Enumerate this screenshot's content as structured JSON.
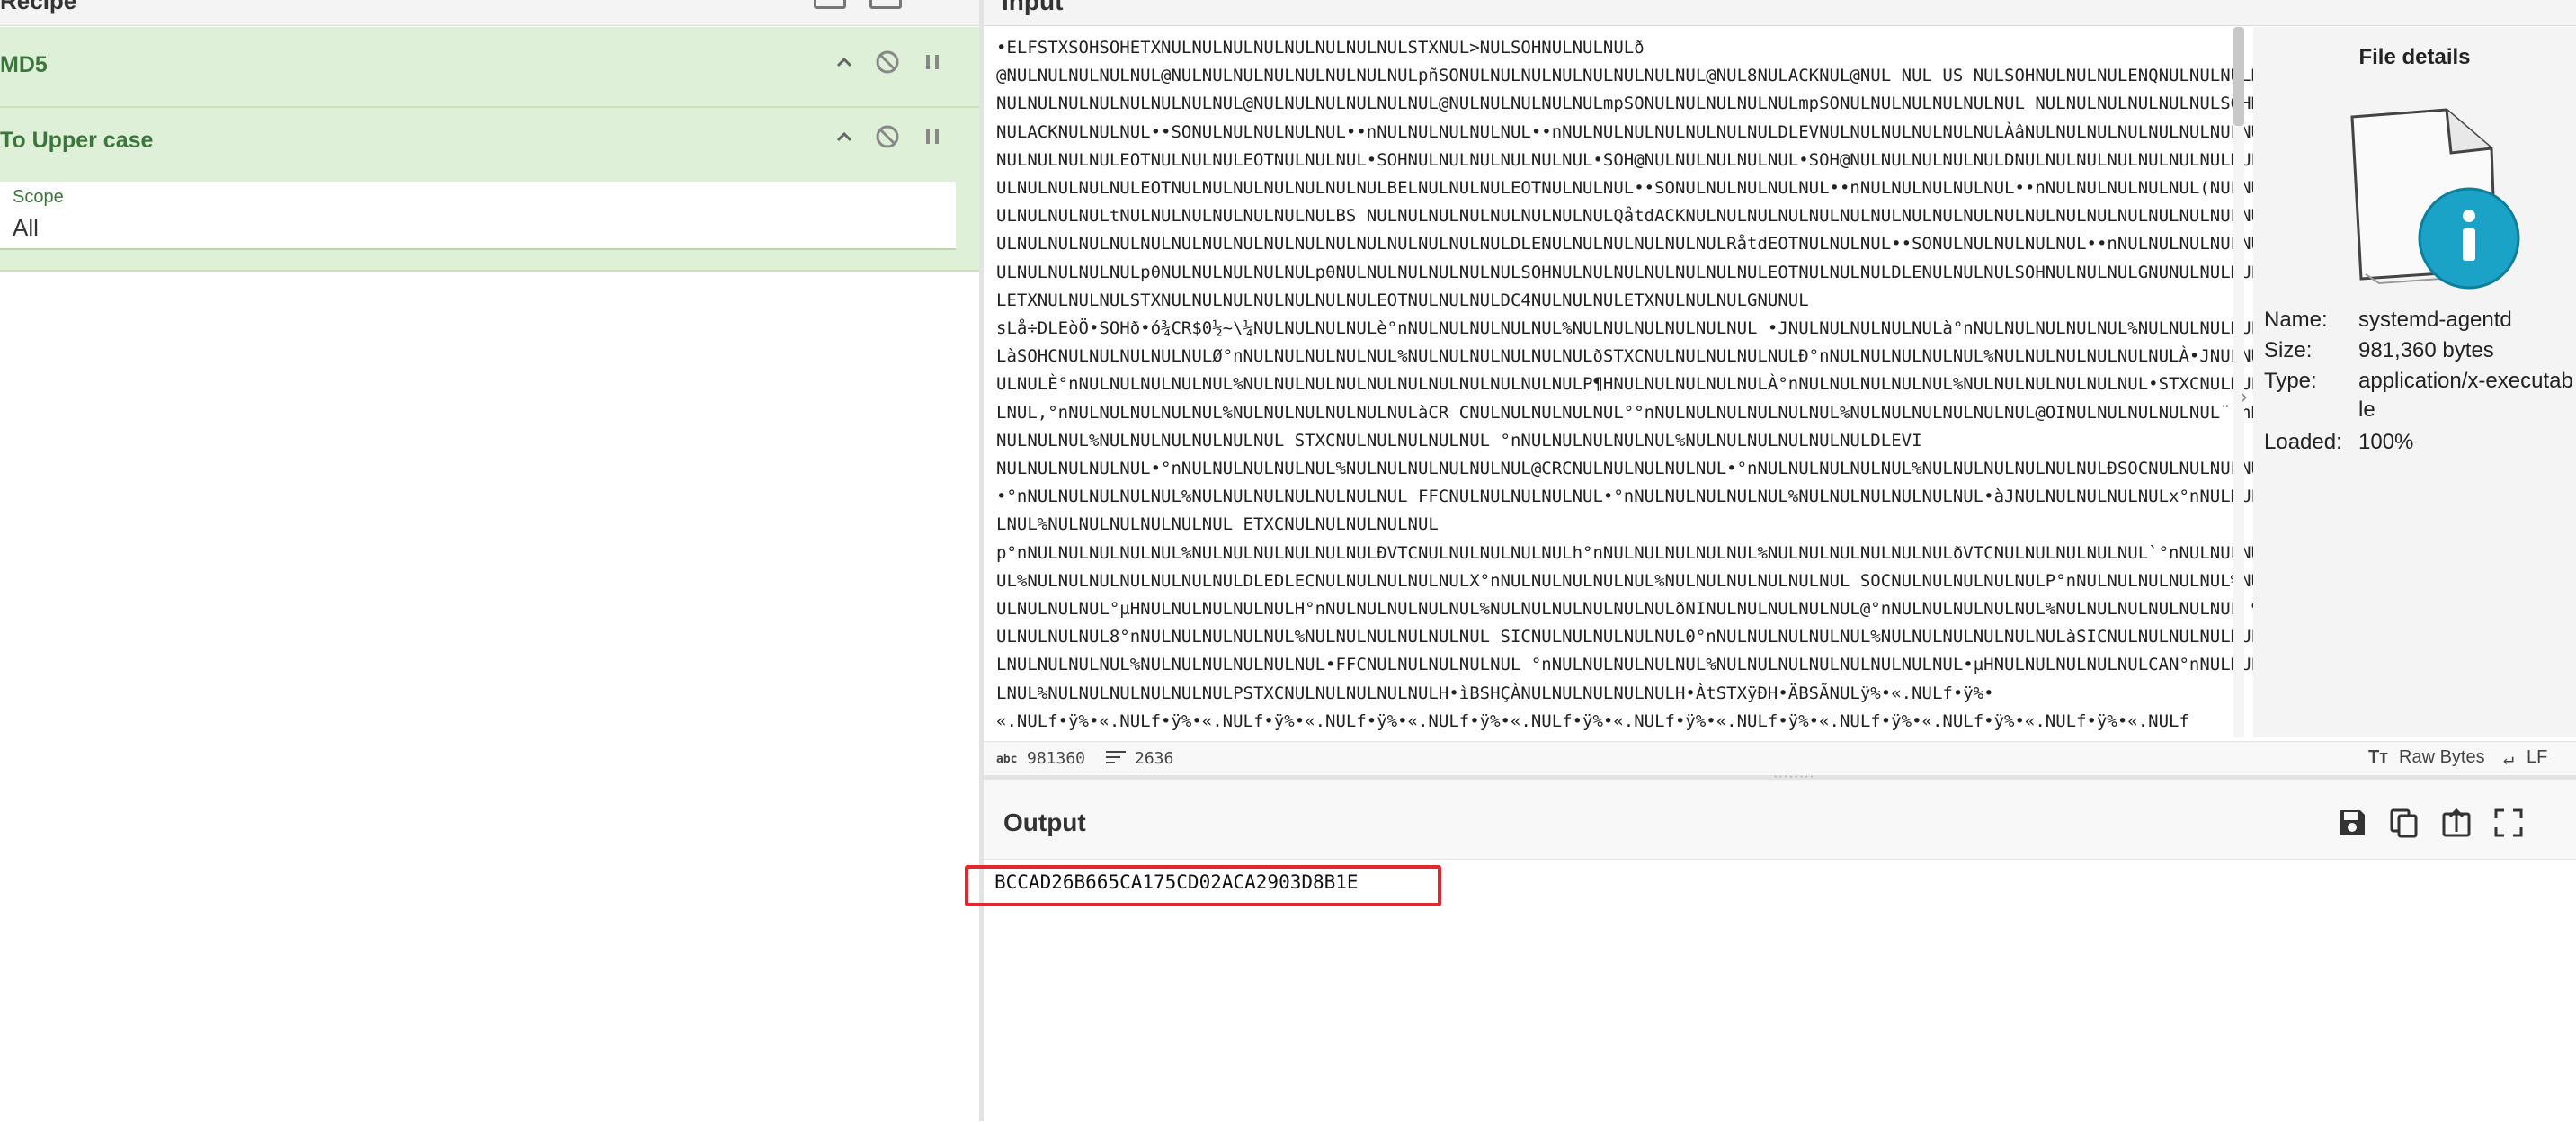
{
  "recipe": {
    "title": "Recipe",
    "operations": [
      {
        "name": "MD5"
      },
      {
        "name": "To Upper case",
        "scope_label": "Scope",
        "scope_value": "All"
      }
    ],
    "op_icons": [
      "chevron-up-icon",
      "disable-icon",
      "pause-icon"
    ]
  },
  "input": {
    "title": "Input",
    "text": "•ELFSTXSOHSOHETXNULNULNULNULNULNULNULNULSTXNUL>NULSOHNULNULNULð\n@NULNULNULNULNUL@NULNULNULNULNULNULNULNULpñSONULNULNULNULNULNULNULNUL@NUL8NULACKNUL@NUL NUL US NULSOHNULNULNULENQNULNULNULNULNULNULNULNULNULNULNULNULNUL@NULNULNULNULNULNUL@NULNULNULNULNULmpSONULNULNULNULNULmpSONULNULNULNULNULNUL NULNULNULNULNULNULSOHNULNULNULACKNULNULNUL••SONULNULNULNULNUL••nNULNULNULNULNUL••nNULNULNULNULNULNULNULDLEVNULNULNULNULNULNULÀâNULNULNULNULNULNULNULNUL NULNULNULNULNULEOTNULNULNULEOTNULNULNUL•SOHNULNULNULNULNULNUL•SOH@NULNULNULNULNUL•SOH@NULNULNULNULNULDNULNULNULNULNULNULNULNULDNULNULNULNULNULNULEOTNULNULNULNULNULNULNULBELNULNULNULEOTNULNULNUL••SONULNULNULNULNUL••nNULNULNULNULNUL••nNULNULNULNULNUL(NULNULNULNULNULNULNULtNULNULNULNULNULNULNULBS NULNULNULNULNULNULNULNULQåtdACKNULNULNULNULNULNULNULNULNULNULNULNULNULNULNULNULNULNULNULNULNULNULNULNULNULNULNULNULNULNULNULNULNULNULNULNULNULDLENULNULNULNULNULNULRåtdEOTNULNULNUL••SONULNULNULNULNUL••nNULNULNULNULNUL••nNULNULNULNULNULpθNULNULNULNULNULpθNULNULNULNULNULNULSOHNULNULNULNULNULNULNULEOTNULNULNULDLENULNULNULSOHNULNULNULGNUNULNULNULNULNULETXNULNULNULSTXNULNULNULNULNULNULNULEOTNULNULNULDC4NULNULNULETXNULNULNULGNUNUL\nsLå÷DLEòÖ•SOHð•ó¾CR$0½~\\¼NULNULNULNULè°nNULNULNULNULNUL%NULNULNULNULNULNUL •JNULNULNULNULNULà°nNULNULNULNULNUL%NULNULNULNULNULNULàSOHCNULNULNULNULNULØ°nNULNULNULNULNUL%NULNULNULNULNULNULðSTXCNULNULNULNULNULÐ°nNULNULNULNULNUL%NULNULNULNULNULNULÀ•JNULNULNULNULNULÈ°nNULNULNULNULNUL%NULNULNULNULNULNULNULNULNULNULNULP¶HNULNULNULNULNULÀ°nNULNULNULNULNUL%NULNULNULNULNULNUL•STXCNULNULNULNULNUL‚°nNULNULNULNULNUL%NULNULNULNULNULNULàCR CNULNULNULNULNUL°°nNULNULNULNULNULNUL%NULNULNULNULNULNUL@OINULNULNULNULNUL¨°nNULNULNULNULNUL%NULNULNULNULNULNUL STXCNULNULNULNULNUL °nNULNULNULNULNUL%NULNULNULNULNULNULDLEVI\nNULNULNULNULNUL•°nNULNULNULNULNUL%NULNULNULNULNULNUL@CRCNULNULNULNULNUL•°nNULNULNULNULNUL%NULNULNULNULNULNULÐSOCNULNULNULNULNUL•°nNULNULNULNULNUL%NULNULNULNULNULNULNUL FFCNULNULNULNULNUL•°nNULNULNULNULNUL%NULNULNULNULNULNUL•àJNULNULNULNULNULx°nNULNULNULNULNUL%NULNULNULNULNULNUL ETXCNULNULNULNULNUL\np°nNULNULNULNULNUL%NULNULNULNULNULNULÐVTCNULNULNULNULNULh°nNULNULNULNULNUL%NULNULNULNULNULNULðVTCNULNULNULNULNUL`°nNULNULNULNULNUL%NULNULNULNULNULNULNULDLEDLECNULNULNULNULNULX°nNULNULNULNULNUL%NULNULNULNULNULNUL SOCNULNULNULNULNULP°nNULNULNULNULNUL%NULNULNULNULNULNUL°µHNULNULNULNULNULH°nNULNULNULNULNUL%NULNULNULNULNULNULðNINULNULNULNULNUL@°nNULNULNULNULNUL%NULNULNULNULNULNUL ¶HNULNULNULNULNUL8°nNULNULNULNULNUL%NULNULNULNULNULNUL SICNULNULNULNULNUL0°nNULNULNULNULNUL%NULNULNULNULNULNULàSICNULNULNULNULNUL(°nNULNULNULNULNUL%NULNULNULNULNULNUL•FFCNULNULNULNULNUL °nNULNULNULNULNUL%NULNULNULNULNULNULNULNUL•µHNULNULNULNULNULCAN°nNULNULNULNULNUL%NULNULNULNULNULNULPSTXCNULNULNULNULNULH•ìBSHÇÀNULNULNULNULNULH•ÀtSTXÿÐH•ÄBSÃNULÿ%•«.NULf•ÿ%•\n«.NULf•ÿ%•«.NULf•ÿ%•«.NULf•ÿ%•«.NULf•ÿ%•«.NULf•ÿ%•«.NULf•ÿ%•«.NULf•ÿ%•«.NULf•ÿ%•«.NULf•ÿ%•«.NULf•ÿ%•«.NULf•ÿ%•«.NULf\n•ÿ%•«.NULf•ÿ%•«.NULf•ÿ%•«.NULf•ÿ%•«.NULf•ÿ%•«.NULf•ÿ%•«.NULf•ÿ%•«.NULf•ÿ%•«.NULf•ÿ%•«.NULf•ÿ%•«.NULf•ÿ%•«.NULf•ÿ%•\n«.NULf•ÿ%•«.NULf•ÿ%•«.NULf•ÃH•ìDLEH•ENQÖ¼.NULL•ENQJöVTNULH•CR•3CRNULA•ñH•5ÜSTXFFNUL•8NULWAPRH•ÂISIEÈL•ENQ•ü VTNUL1ÿ1Àèþ´\nSOHNULH•=¿².NULH•Ä è•ºSOHNULè)•SOHNULH•CRB/FFNULH•5SOH.FFNULH•=BS.FFNULH•ìBSºuNULNULNULèVÎNULNULH•5O1FFNUL¿STXNULNULNULH•ìBS1Àè?"
  },
  "file_details": {
    "title": "File details",
    "rows": [
      {
        "key": "Name:",
        "value": "systemd-agentd"
      },
      {
        "key": "Size:",
        "value": "981,360 bytes"
      },
      {
        "key": "Type:",
        "value": "application/x-executable"
      },
      {
        "key": "Loaded:",
        "value": "100%"
      }
    ],
    "icon": "file-info-icon"
  },
  "status": {
    "abc_label": "abc",
    "length": "981360",
    "lines": "2636",
    "raw_bytes": "Raw Bytes",
    "eol": "LF"
  },
  "output": {
    "title": "Output",
    "text": "BCCAD26B665CA175CD02ACA2903D8B1E",
    "icons": [
      "save-icon",
      "copy-icon",
      "replace-input-icon",
      "maximize-icon"
    ]
  },
  "colors": {
    "op_bg": "#dff0d8",
    "op_text": "#3c763d",
    "highlight": "#e0282d",
    "control_char": "#d40000"
  }
}
